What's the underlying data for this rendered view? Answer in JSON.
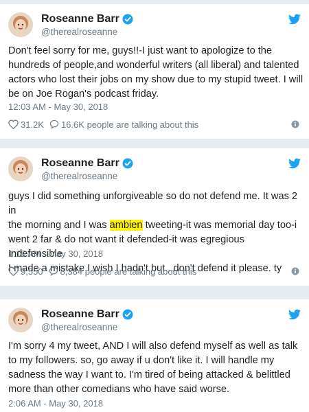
{
  "tweets": [
    {
      "name": "Roseanne Barr",
      "handle": "@therealroseanne",
      "text_lines": [
        "Don't feel sorry for me, guys!!-I just want to apologize to the",
        "hundreds of people,and wonderful writers (all liberal) and talented",
        "actors who lost their jobs on my show due to my stupid tweet. I will",
        "be on Joe Rogan's podcast friday."
      ],
      "time": "12:03 AM - May 30, 2018",
      "likes": "31.2K",
      "talking": "16.6K people are talking about this"
    },
    {
      "name": "Roseanne Barr",
      "handle": "@therealroseanne",
      "text_lines": [
        "guys I did something unforgiveable so do not defend me. It was 2 in",
        "the morning and I was |ambien| tweeting-it was memorial day too-i",
        "went 2 far & do not want it defended-it was egregious Indefensible.",
        "I made a mistake I wish I hadn't but...don't defend it please. ty"
      ],
      "line2_pre": "the morning and I was ",
      "line2_highlight": "ambien",
      "line2_post": " tweeting-it was memorial day too-i",
      "time": "1:15 AM - May 30, 2018",
      "likes": "9,550",
      "talking": "8,384 people are talking about this"
    },
    {
      "name": "Roseanne Barr",
      "handle": "@therealroseanne",
      "text_lines": [
        "I'm sorry 4 my tweet, AND I will also defend myself as well as talk",
        "to my followers. so, go away if u don't like it. I will handle my",
        "sadness the way I want to. I'm tired of being attacked & belittled",
        "more than other comedians who have said worse."
      ],
      "time": "2:06 AM - May 30, 2018"
    }
  ],
  "colors": {
    "divider": "#e6ecf0",
    "twitter_blue": "#1da1f2",
    "secondary_text": "#697882",
    "highlight": "#fff200"
  },
  "icons": [
    "avatar",
    "verified-badge-icon",
    "twitter-bird-icon",
    "heart-icon",
    "reply-bubble-icon",
    "info-icon"
  ]
}
